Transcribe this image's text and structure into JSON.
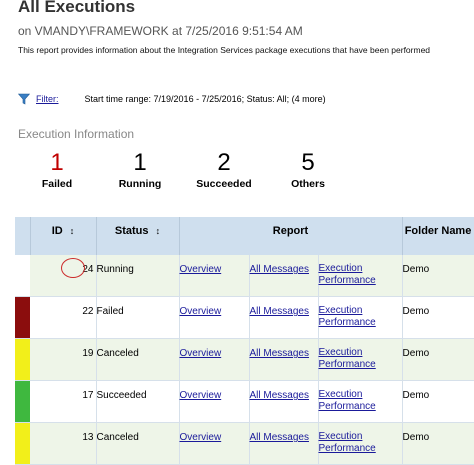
{
  "header": {
    "title": "All Executions",
    "subtitle": "on VMANDY\\FRAMEWORK at 7/25/2016 9:51:54 AM",
    "description": "This report provides information about the Integration Services package executions that have been performed"
  },
  "filter": {
    "label": "Filter:",
    "summary": "Start time range: 7/19/2016 - 7/25/2016;  Status: All;  (4 more)"
  },
  "section_title": "Execution Information",
  "stats": [
    {
      "value": "1",
      "label": "Failed"
    },
    {
      "value": "1",
      "label": "Running"
    },
    {
      "value": "2",
      "label": "Succeeded"
    },
    {
      "value": "5",
      "label": "Others"
    }
  ],
  "table": {
    "headers": {
      "id": "ID",
      "status": "Status",
      "report": "Report",
      "folder": "Folder Name"
    },
    "rows": [
      {
        "id": "24",
        "status": "Running",
        "overview": "Overview",
        "messages": "All Messages",
        "perf1": "Execution",
        "perf2": "Performance",
        "folder": "Demo",
        "color": "#ffffff"
      },
      {
        "id": "22",
        "status": "Failed",
        "overview": "Overview",
        "messages": "All Messages",
        "perf1": "Execution",
        "perf2": "Performance",
        "folder": "Demo",
        "color": "#8b0d0d"
      },
      {
        "id": "19",
        "status": "Canceled",
        "overview": "Overview",
        "messages": "All Messages",
        "perf1": "Execution",
        "perf2": "Performance",
        "folder": "Demo",
        "color": "#f2ef1a"
      },
      {
        "id": "17",
        "status": "Succeeded",
        "overview": "Overview",
        "messages": "All Messages",
        "perf1": "Execution",
        "perf2": "Performance",
        "folder": "Demo",
        "color": "#3fb83f"
      },
      {
        "id": "13",
        "status": "Canceled",
        "overview": "Overview",
        "messages": "All Messages",
        "perf1": "Execution",
        "perf2": "Performance",
        "folder": "Demo",
        "color": "#f2ef1a"
      }
    ]
  },
  "colors": {
    "failed_accent": "#c00000",
    "link": "#1a1a9a",
    "header_bg": "#cfdfee",
    "alt_row_bg": "#eef5e8"
  },
  "icons": {
    "filter": "funnel-icon",
    "sort": "sort-arrows-icon"
  }
}
